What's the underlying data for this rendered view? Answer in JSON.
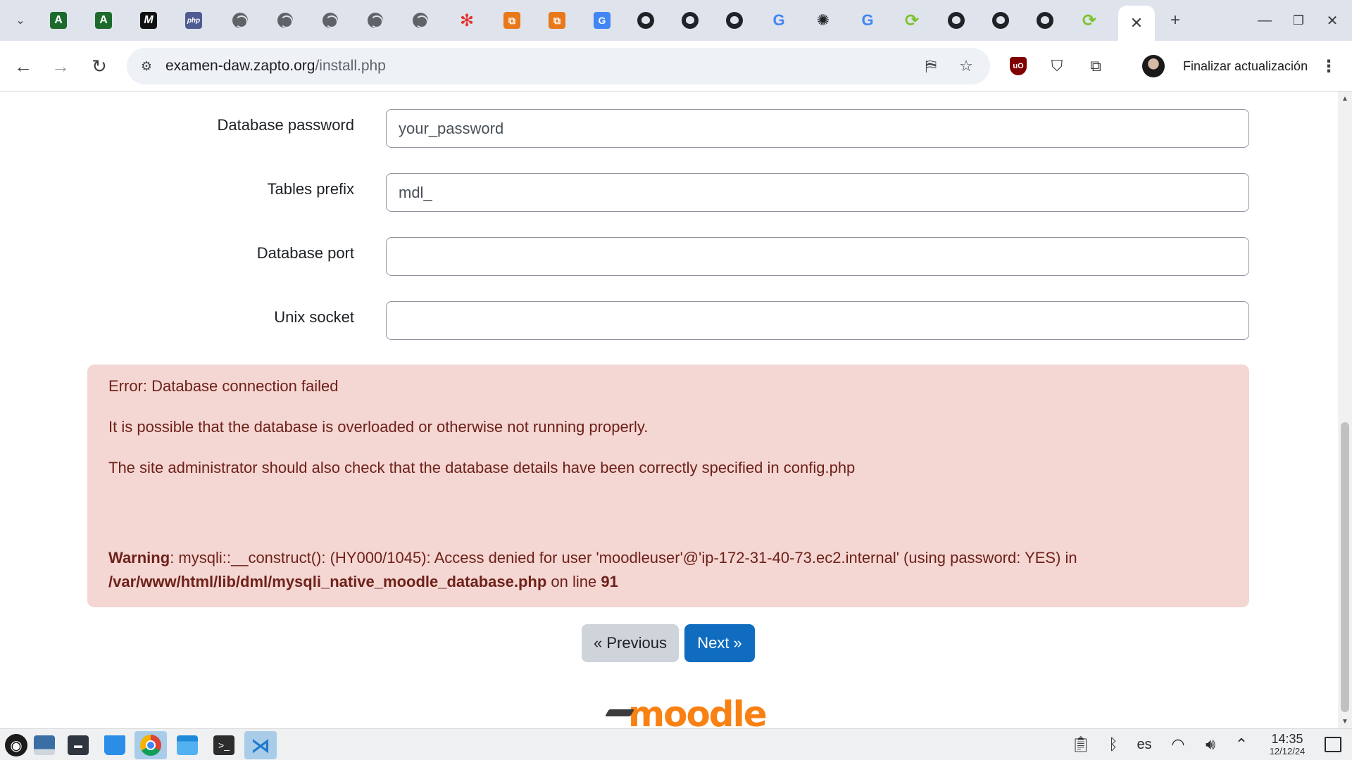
{
  "browser": {
    "tabs": [
      {
        "icon": "angular-icon",
        "glyph": "A",
        "color": "#1c6b2d"
      },
      {
        "icon": "angular-icon",
        "glyph": "A",
        "color": "#1c6b2d"
      },
      {
        "icon": "medium-icon",
        "glyph": "M",
        "color": "#111111"
      },
      {
        "icon": "php-icon",
        "glyph": "php",
        "color": "#4f5b93"
      },
      {
        "icon": "globe-icon"
      },
      {
        "icon": "globe-icon"
      },
      {
        "icon": "globe-icon"
      },
      {
        "icon": "globe-icon"
      },
      {
        "icon": "globe-icon"
      },
      {
        "icon": "snowflake-icon",
        "color": "#e2312d"
      },
      {
        "icon": "aws-icon",
        "color": "#e8781a"
      },
      {
        "icon": "aws-icon",
        "color": "#e8781a"
      },
      {
        "icon": "google-translate-icon",
        "color": "#4285f4"
      },
      {
        "icon": "github-icon"
      },
      {
        "icon": "github-icon"
      },
      {
        "icon": "github-icon"
      },
      {
        "icon": "google-icon",
        "glyph": "G"
      },
      {
        "icon": "openai-icon",
        "glyph": "✺"
      },
      {
        "icon": "google-icon",
        "glyph": "G"
      },
      {
        "icon": "refresh-green-icon",
        "color": "#7cc22b"
      },
      {
        "icon": "github-icon"
      },
      {
        "icon": "github-icon"
      },
      {
        "icon": "github-icon"
      },
      {
        "icon": "refresh-green-icon",
        "color": "#7cc22b"
      }
    ],
    "active_tab_close": "✕",
    "new_tab": "+",
    "url_host": "examen-daw.zapto.org",
    "url_path": "/install.php",
    "update_label": "Finalizar actualización"
  },
  "form": {
    "fields": [
      {
        "label": "Database password",
        "value": "your_password"
      },
      {
        "label": "Tables prefix",
        "value": "mdl_"
      },
      {
        "label": "Database port",
        "value": ""
      },
      {
        "label": "Unix socket",
        "value": ""
      }
    ]
  },
  "error": {
    "title": "Error: Database connection failed",
    "line1": "It is possible that the database is overloaded or otherwise not running properly.",
    "line2": "The site administrator should also check that the database details have been correctly specified in config.php",
    "warning_label": "Warning",
    "warning_text": ": mysqli::__construct(): (HY000/1045): Access denied for user 'moodleuser'@'ip-172-31-40-73.ec2.internal' (using password: YES) in",
    "warning_file": "/var/www/html/lib/dml/mysqli_native_moodle_database.php",
    "warning_online": " on line ",
    "warning_line": "91"
  },
  "buttons": {
    "previous": "« Previous",
    "next": "Next »"
  },
  "logo": {
    "text": "moodle",
    "color": "#f98012"
  },
  "taskbar": {
    "language": "es",
    "time": "14:35",
    "date": "12/12/24"
  },
  "colors": {
    "error_bg": "#f4d6d2",
    "error_text": "#6e211a",
    "primary": "#0f6cbf",
    "secondary": "#ced4da"
  }
}
